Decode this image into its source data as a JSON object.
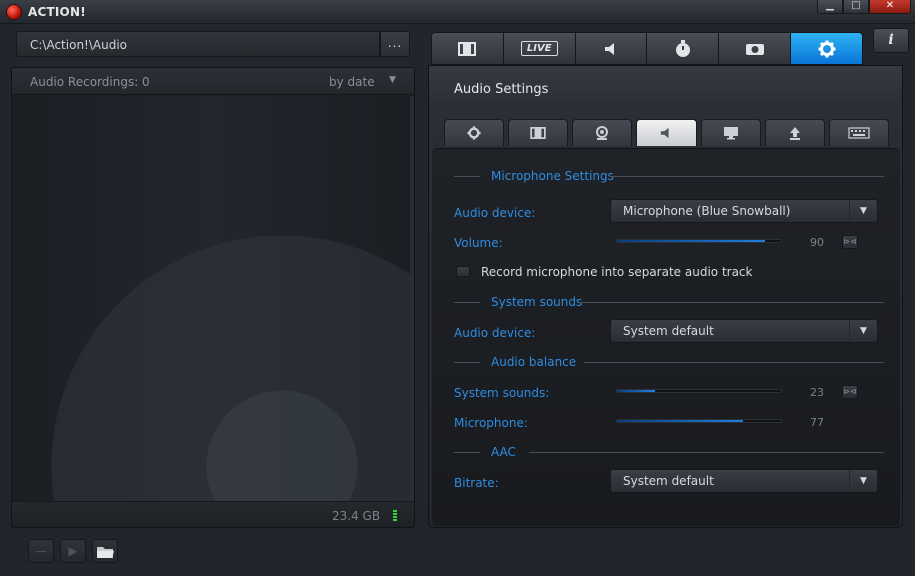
{
  "window": {
    "title": "ACTION!",
    "min_glyph": "▁",
    "max_glyph": "□",
    "close_glyph": "✕"
  },
  "path": {
    "value": "C:\\Action!\\Audio",
    "browse_label": "..."
  },
  "recordings": {
    "count_label": "Audio Recordings: 0",
    "sort_label": "by date",
    "sort_arrow": "▼",
    "disk_space": "23.4 GB"
  },
  "bottom_buttons": {
    "remove": "—",
    "play": "▶",
    "folder": "📂"
  },
  "top_tabs": {
    "live_label": "LIVE",
    "info_label": "i",
    "active_index": 5
  },
  "settings": {
    "title": "Audio Settings",
    "sub_tab_active_index": 3,
    "microphone_section": "Microphone Settings",
    "mic_device_label": "Audio device:",
    "mic_device_value": "Microphone (Blue Snowball)",
    "volume_label": "Volume:",
    "volume_value": 90,
    "record_separate_label": "Record microphone into separate audio track",
    "record_separate_checked": false,
    "system_sounds_section": "System sounds",
    "sys_device_label": "Audio device:",
    "sys_device_value": "System default",
    "balance_section": "Audio balance",
    "balance_system_label": "System sounds:",
    "balance_system_value": 23,
    "balance_mic_label": "Microphone:",
    "balance_mic_value": 77,
    "aac_section": "AAC",
    "bitrate_label": "Bitrate:",
    "bitrate_value": "System default",
    "dropdown_arrow": "▼",
    "link_glyph": "⊳⊲"
  },
  "colors": {
    "accent": "#1e7fe0",
    "active_tab": "#0a74d6",
    "label_blue": "#2f8de0",
    "record_red": "#c0140a",
    "meter_green": "#3bd13b"
  }
}
